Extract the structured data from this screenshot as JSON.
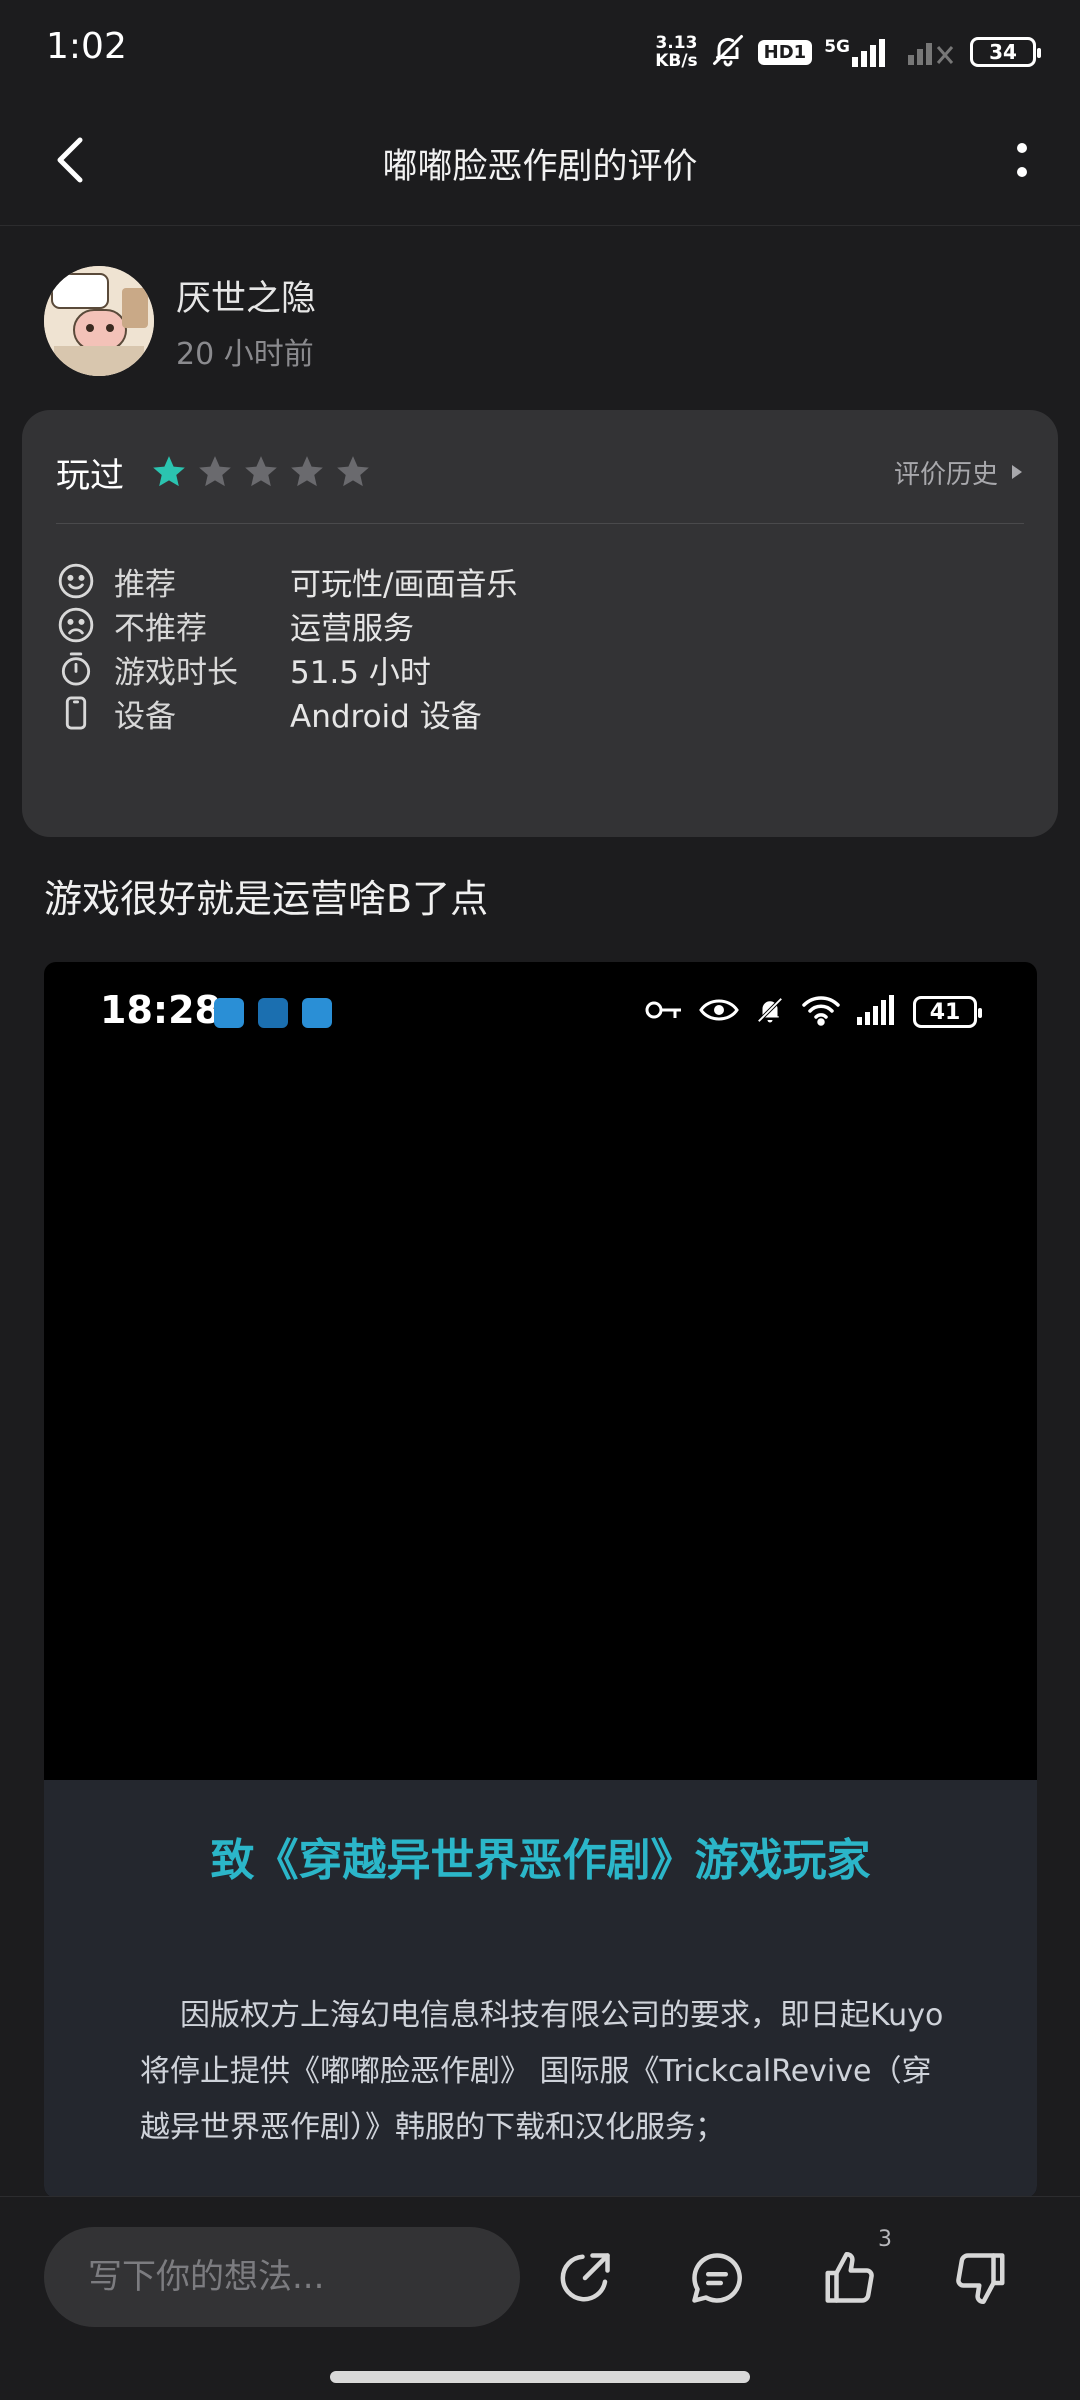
{
  "status_bar": {
    "time": "1:02",
    "net_speed_value": "3.13",
    "net_speed_unit": "KB/s",
    "hd_badge": "HD1",
    "network": "5G",
    "battery": "34"
  },
  "nav": {
    "title": "嘟嘟脸恶作剧的评价"
  },
  "author": {
    "name": "厌世之隐",
    "time": "20 小时前"
  },
  "rating": {
    "played_label": "玩过",
    "stars_filled": 1,
    "stars_total": 5,
    "star_color": "#2bc4b0",
    "history_label": "评价历史",
    "rows": [
      {
        "icon": "smile-icon",
        "label": "推荐",
        "value": "可玩性/画面音乐"
      },
      {
        "icon": "frown-icon",
        "label": "不推荐",
        "value": "运营服务"
      },
      {
        "icon": "stopwatch-icon",
        "label": "游戏时长",
        "value": "51.5 小时"
      },
      {
        "icon": "phone-icon",
        "label": "设备",
        "value": "Android 设备"
      }
    ]
  },
  "review": {
    "text": "游戏很好就是运营啥B了点"
  },
  "review_image": {
    "status_time": "18:28",
    "battery": "41",
    "notice_title": "致《穿越异世界恶作剧》游戏玩家",
    "notice_body": "因版权方上海幻电信息科技有限公司的要求，即日起Kuyo将停止提供《嘟嘟脸恶作剧》 国际服《TrickcalRevive（穿越异世界恶作剧）》韩服的下载和汉化服务；"
  },
  "bottom_bar": {
    "comment_placeholder": "写下你的想法...",
    "like_count": "3"
  }
}
